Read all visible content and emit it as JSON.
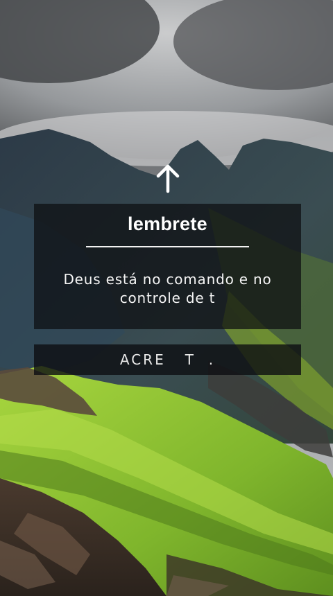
{
  "reminder_card": {
    "title": "lembrete",
    "message": "Deus está no comando e no controle de t"
  },
  "action_bar": {
    "label": "ACRE   T  ."
  },
  "icons": {
    "swipe_up": "arrow-up-icon"
  },
  "colors": {
    "card_background": "#0c0e11",
    "text": "#ffffff",
    "grass": "#9fcf3a"
  }
}
